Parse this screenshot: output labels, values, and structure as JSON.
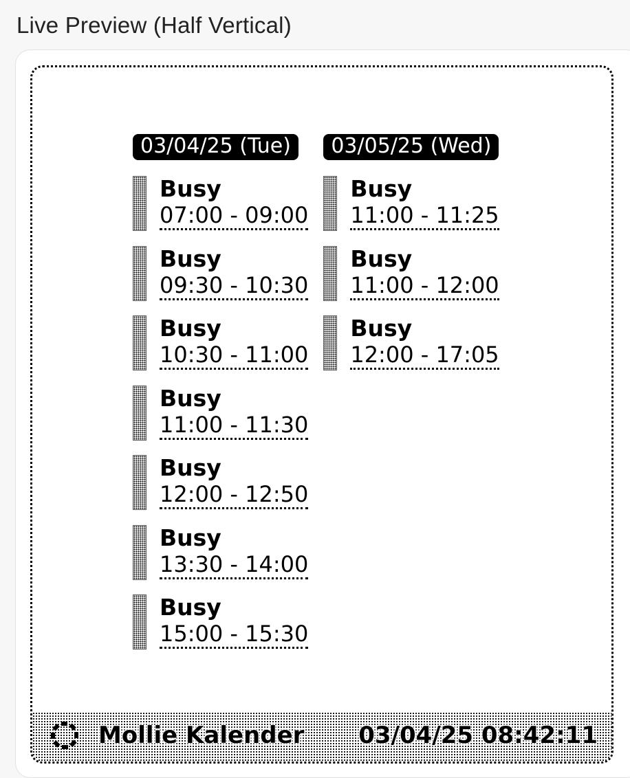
{
  "panel_title": "Live Preview (Half Vertical)",
  "calendar": {
    "days": [
      {
        "date_label": "03/04/25 (Tue)",
        "events": [
          {
            "title": "Busy",
            "time": "07:00 - 09:00"
          },
          {
            "title": "Busy",
            "time": "09:30 - 10:30"
          },
          {
            "title": "Busy",
            "time": "10:30 - 11:00"
          },
          {
            "title": "Busy",
            "time": "11:00 - 11:30"
          },
          {
            "title": "Busy",
            "time": "12:00 - 12:50"
          },
          {
            "title": "Busy",
            "time": "13:30 - 14:00"
          },
          {
            "title": "Busy",
            "time": "15:00 - 15:30"
          }
        ]
      },
      {
        "date_label": "03/05/25 (Wed)",
        "events": [
          {
            "title": "Busy",
            "time": "11:00 - 11:25"
          },
          {
            "title": "Busy",
            "time": "11:00 - 12:00"
          },
          {
            "title": "Busy",
            "time": "12:00 - 17:05"
          }
        ]
      }
    ]
  },
  "footer": {
    "logo_icon": "mollie-calendar-logo-icon",
    "brand": "Mollie Kalender",
    "timestamp": "03/04/25 08:42:11"
  }
}
